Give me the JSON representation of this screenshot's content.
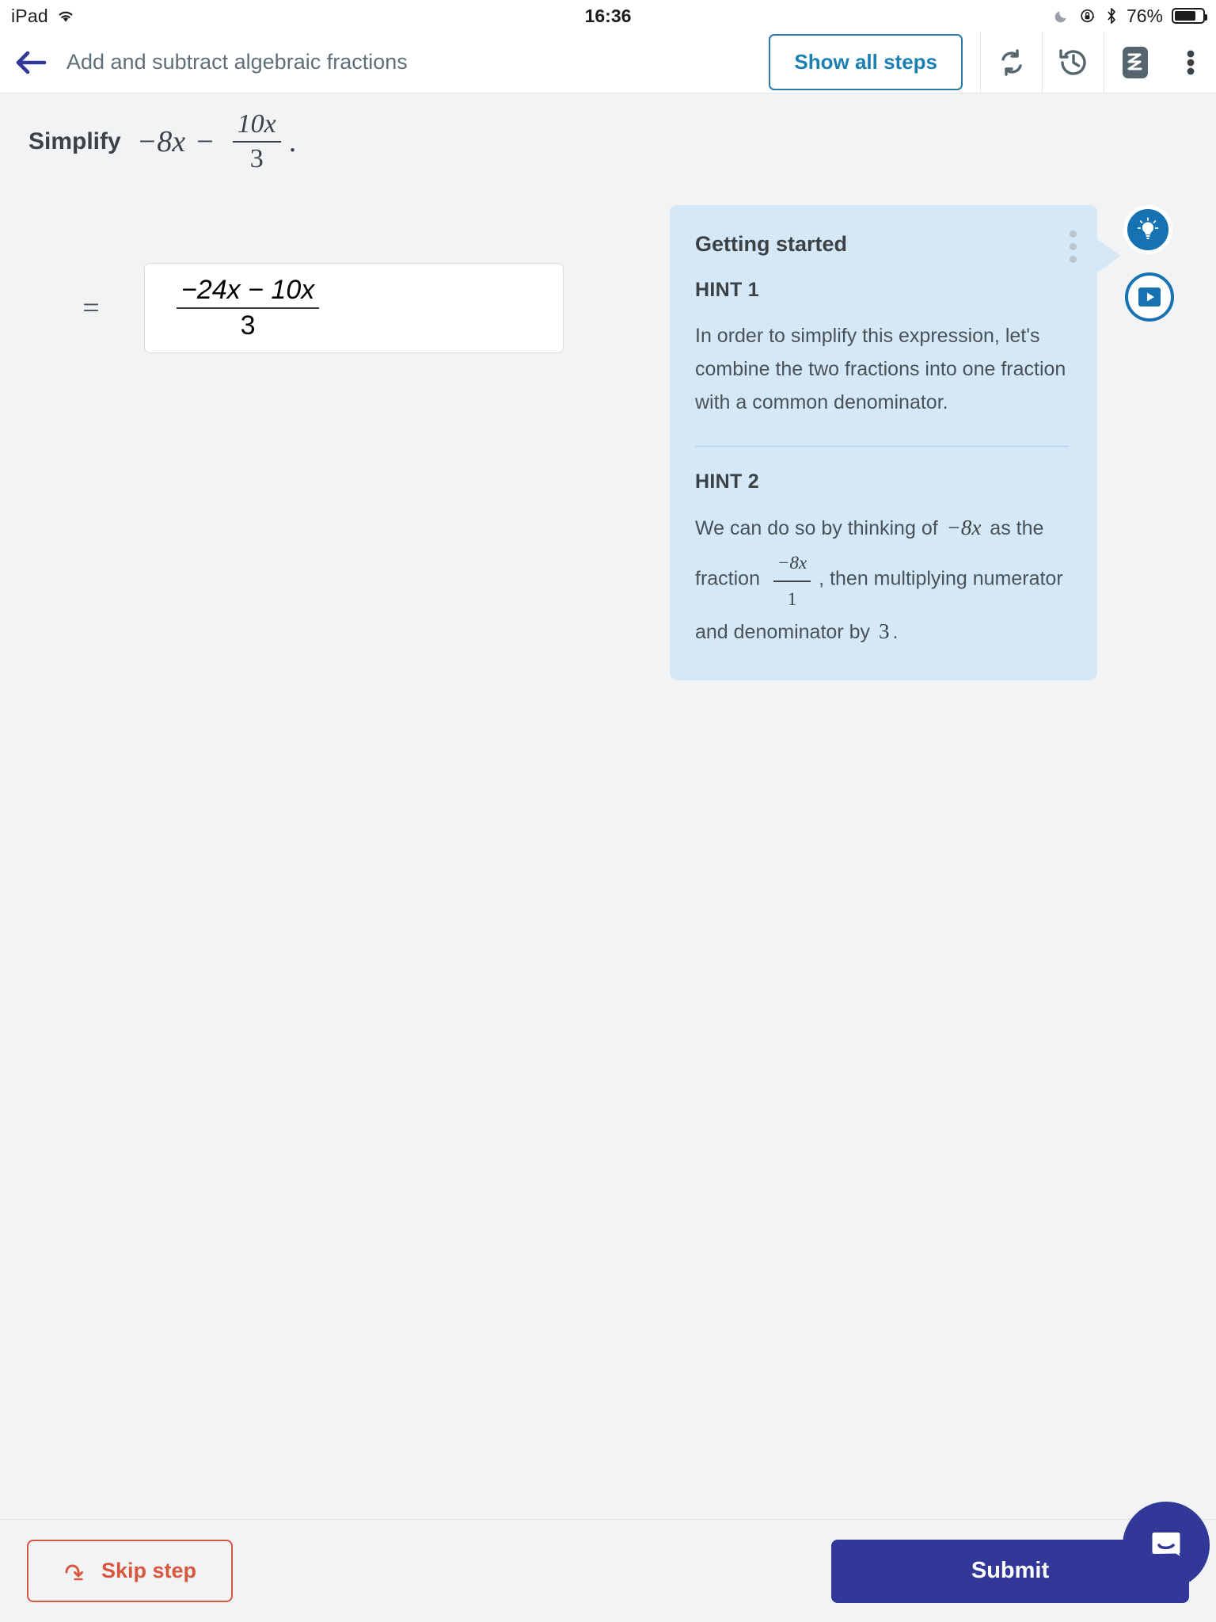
{
  "status_bar": {
    "device": "iPad",
    "wifi_icon": "wifi-icon",
    "time": "16:36",
    "dnd_icon": "moon-icon",
    "rotation_lock_icon": "rotation-lock-icon",
    "bluetooth_icon": "bluetooth-icon",
    "battery_text": "76%",
    "battery_percent": 76
  },
  "header": {
    "back_icon": "back-arrow-icon",
    "title": "Add and subtract algebraic fractions",
    "show_all_steps_label": "Show all steps",
    "tools": [
      {
        "name": "refresh-icon",
        "label": "Refresh"
      },
      {
        "name": "history-icon",
        "label": "History"
      },
      {
        "name": "scribble-pad-icon",
        "label": "Scribble"
      },
      {
        "name": "overflow-menu-icon",
        "label": "More options"
      }
    ]
  },
  "problem": {
    "label": "Simplify",
    "term": "−8x",
    "operator": "−",
    "fraction": {
      "numerator": "10x",
      "denominator": "3"
    },
    "period": "."
  },
  "step": {
    "equals": "=",
    "answer": {
      "numerator": "−24x − 10x",
      "denominator": "3"
    }
  },
  "hint_panel": {
    "title": "Getting started",
    "menu_icon": "overflow-menu-icon",
    "hints": [
      {
        "label": "HINT 1",
        "text": "In order to simplify this expression, let's combine the two fractions into one fraction with a common denominator."
      },
      {
        "label": "HINT 2",
        "text_part1": "We can do so by thinking of",
        "math1": "−8x",
        "text_part2": "as the fraction",
        "fraction": {
          "numerator": "−8x",
          "denominator": "1"
        },
        "text_part3": ", then multiplying numerator and denominator by",
        "math2": "3",
        "text_part4": "."
      }
    ]
  },
  "floating_buttons": {
    "hint_icon": "lightbulb-icon",
    "video_icon": "play-video-icon"
  },
  "footer": {
    "skip_icon": "skip-arrow-icon",
    "skip_label": "Skip step",
    "submit_label": "Submit",
    "chat_icon": "chat-bubble-icon"
  },
  "colors": {
    "accent_blue": "#1672b0",
    "indigo": "#323897",
    "skip_red": "#d9563f",
    "hint_bg": "#d4e8f7",
    "page_bg": "#f1f3f4"
  }
}
